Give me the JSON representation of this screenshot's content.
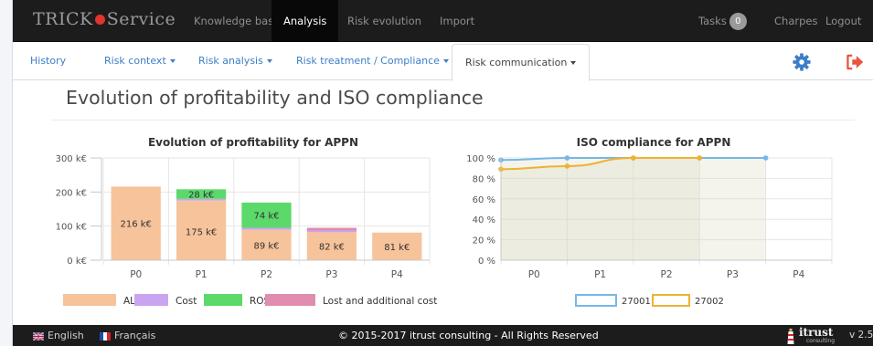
{
  "app": {
    "brand_prefix": "TRICK",
    "brand_suffix": "Service"
  },
  "navbar": {
    "items": [
      {
        "label": "Knowledge base"
      },
      {
        "label": "Analysis"
      },
      {
        "label": "Risk evolution"
      },
      {
        "label": "Import"
      }
    ],
    "tasks_label": "Tasks",
    "tasks_count": "0",
    "user_label": "Charpes",
    "logout_label": "Logout"
  },
  "subnav": {
    "tabs": [
      {
        "label": "History"
      },
      {
        "label": "Risk context"
      },
      {
        "label": "Risk analysis"
      },
      {
        "label": "Risk treatment / Compliance"
      },
      {
        "label": "Risk communication"
      }
    ],
    "icons": [
      "gear-icon",
      "sign-out-icon"
    ]
  },
  "page": {
    "title": "Evolution of profitability and ISO compliance"
  },
  "colors": {
    "ale": "#f7c39b",
    "cost": "#c9a5f1",
    "rosi": "#5bd96a",
    "lost": "#e08db0",
    "iso_27001": "#75b8e8",
    "iso_27002": "#f0b22e",
    "navbar": "#1c1c1c",
    "link": "#3c7ec7"
  },
  "chart_data": [
    {
      "type": "bar",
      "stacked": true,
      "title": "Evolution of profitability for APPN",
      "categories": [
        "P0",
        "P1",
        "P2",
        "P3",
        "P4"
      ],
      "y_ticks": [
        "0 k€",
        "100 k€",
        "200 k€",
        "300 k€"
      ],
      "ylim": [
        0,
        300
      ],
      "unit": "k€",
      "series": [
        {
          "name": "ALE",
          "values": [
            216,
            175,
            89,
            82,
            81
          ]
        },
        {
          "name": "Cost",
          "values": [
            0,
            5,
            6,
            5,
            0
          ]
        },
        {
          "name": "ROSI",
          "values": [
            0,
            28,
            74,
            0,
            0
          ]
        },
        {
          "name": "Lost and additional cost",
          "values": [
            0,
            0,
            0,
            8,
            0
          ]
        }
      ],
      "data_labels": {
        "ALE": [
          "216 k€",
          "175 k€",
          "89 k€",
          "82 k€",
          "81 k€"
        ],
        "ROSI": [
          "",
          "28 k€",
          "74 k€",
          "",
          ""
        ]
      },
      "grid": true,
      "legend_position": "bottom"
    },
    {
      "type": "area",
      "title": "ISO compliance for APPN",
      "categories": [
        "P0",
        "P1",
        "P2",
        "P3",
        "P4"
      ],
      "y_ticks": [
        "0 %",
        "20 %",
        "40 %",
        "60 %",
        "80 %",
        "100 %"
      ],
      "ylim": [
        0,
        100
      ],
      "series": [
        {
          "name": "27001",
          "values": [
            98,
            100,
            100,
            100,
            100
          ]
        },
        {
          "name": "27002",
          "values": [
            89,
            92,
            100,
            100,
            null
          ]
        }
      ],
      "grid": true,
      "legend_position": "bottom"
    }
  ],
  "footer": {
    "lang_en": "English",
    "lang_fr": "Français",
    "copyright": "© 2015-2017 itrust consulting - All Rights Reserved",
    "logo_name": "itrust",
    "logo_sub": "consulting",
    "version": "v 2.5"
  }
}
